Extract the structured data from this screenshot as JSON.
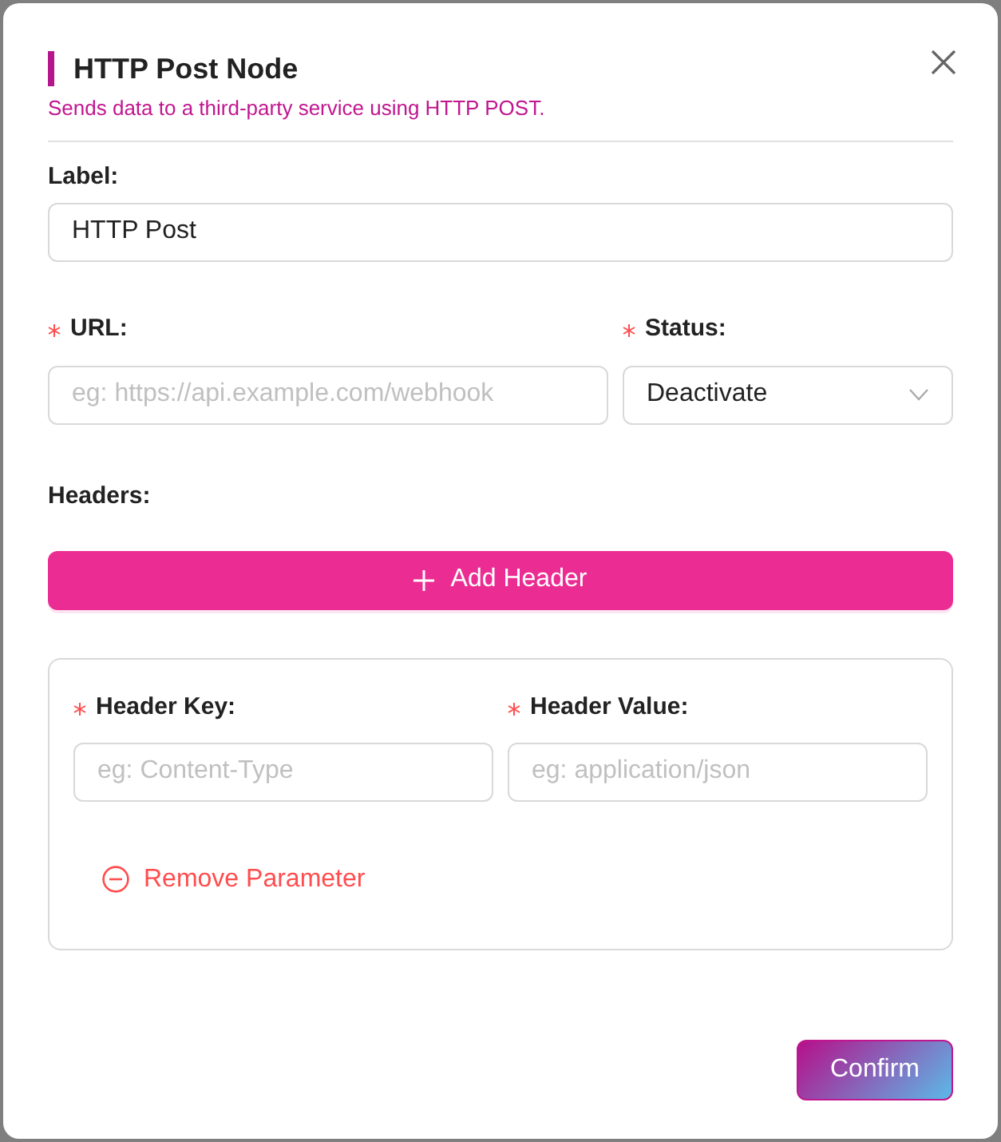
{
  "dialog": {
    "title": "HTTP Post Node",
    "subtitle": "Sends data to a third-party service using HTTP POST."
  },
  "label_field": {
    "label": "Label:",
    "value": "HTTP Post"
  },
  "url_field": {
    "label": "URL:",
    "placeholder": "eg: https://api.example.com/webhook",
    "required": true
  },
  "status_field": {
    "label": "Status:",
    "value": "Deactivate",
    "required": true
  },
  "headers": {
    "label": "Headers:",
    "add_button": "Add Header",
    "items": [
      {
        "key_label": "Header Key:",
        "key_placeholder": "eg: Content-Type",
        "value_label": "Header Value:",
        "value_placeholder": "eg: application/json",
        "required": true,
        "remove_button": "Remove Parameter"
      }
    ]
  },
  "confirm_button": "Confirm"
}
